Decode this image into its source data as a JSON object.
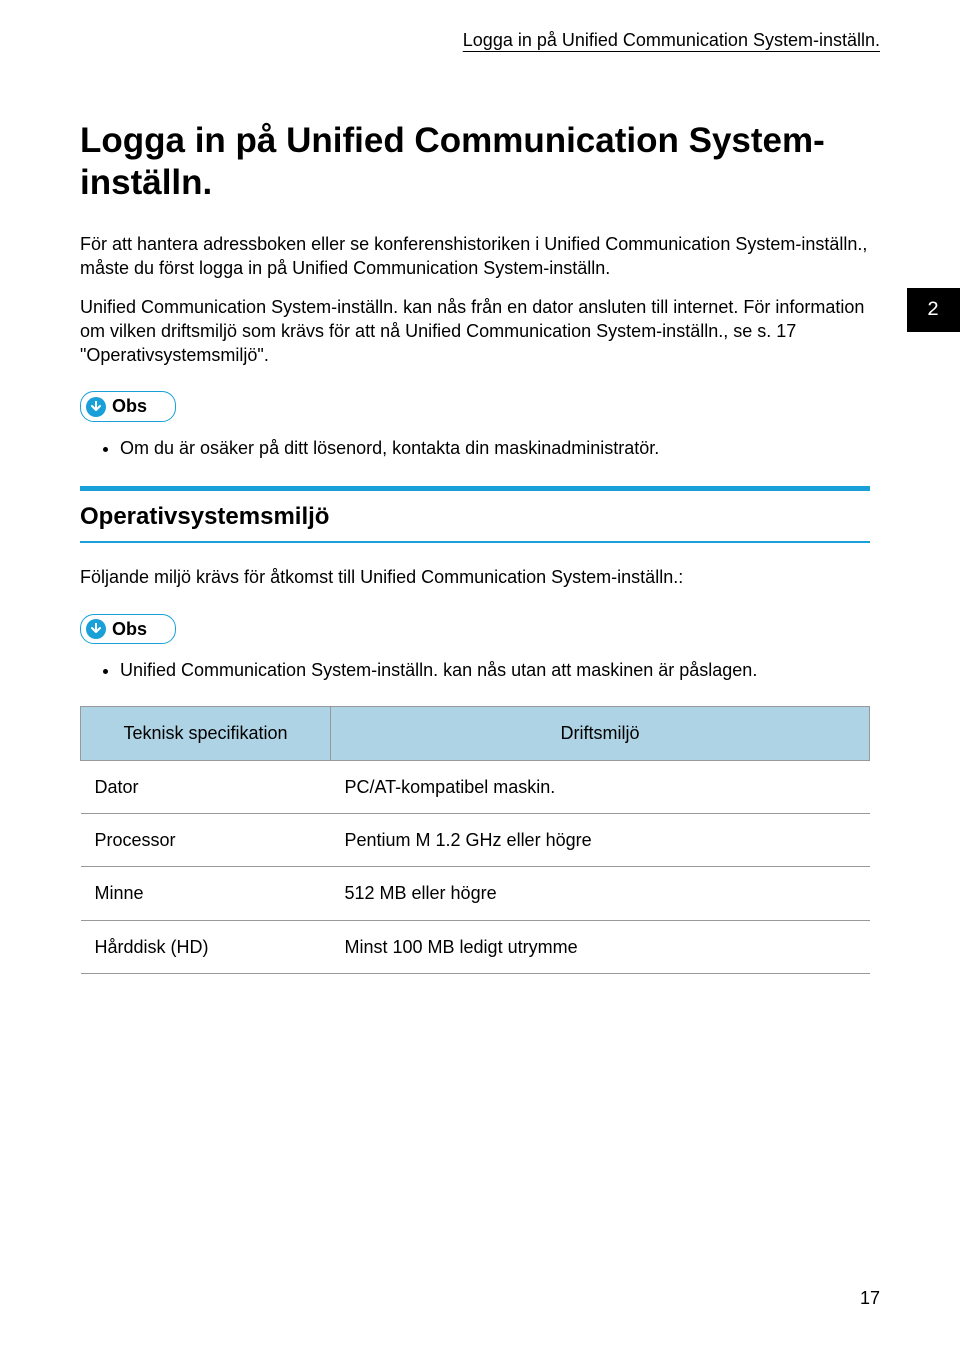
{
  "header": {
    "running_title": "Logga in på Unified Communication System-inställn."
  },
  "main": {
    "title": "Logga in på Unified Communication System-inställn.",
    "para1": "För att hantera adressboken eller se konferenshistoriken i Unified Communication System-inställn., måste du först logga in på Unified Communication System-inställn.",
    "para2": "Unified Communication System-inställn. kan nås från en dator ansluten till internet. För information om vilken driftsmiljö som krävs för att nå Unified Communication System-inställn., se s. 17 \"Operativsystemsmiljö\".",
    "obs_label": "Obs",
    "obs_items": [
      "Om du är osäker på ditt lösenord, kontakta din maskinadministratör."
    ]
  },
  "chapter_number": "2",
  "section": {
    "title": "Operativsystemsmiljö",
    "intro": "Följande miljö krävs för åtkomst till Unified Communication System-inställn.:",
    "obs_label": "Obs",
    "obs_items": [
      "Unified Communication System-inställn. kan nås utan att maskinen är påslagen."
    ],
    "table": {
      "headers": [
        "Teknisk specifikation",
        "Driftsmiljö"
      ],
      "rows": [
        [
          "Dator",
          "PC/AT-kompatibel maskin."
        ],
        [
          "Processor",
          "Pentium M 1.2 GHz eller högre"
        ],
        [
          "Minne",
          "512 MB eller högre"
        ],
        [
          "Hårddisk (HD)",
          "Minst 100 MB ledigt utrymme"
        ]
      ]
    }
  },
  "page_number": "17"
}
